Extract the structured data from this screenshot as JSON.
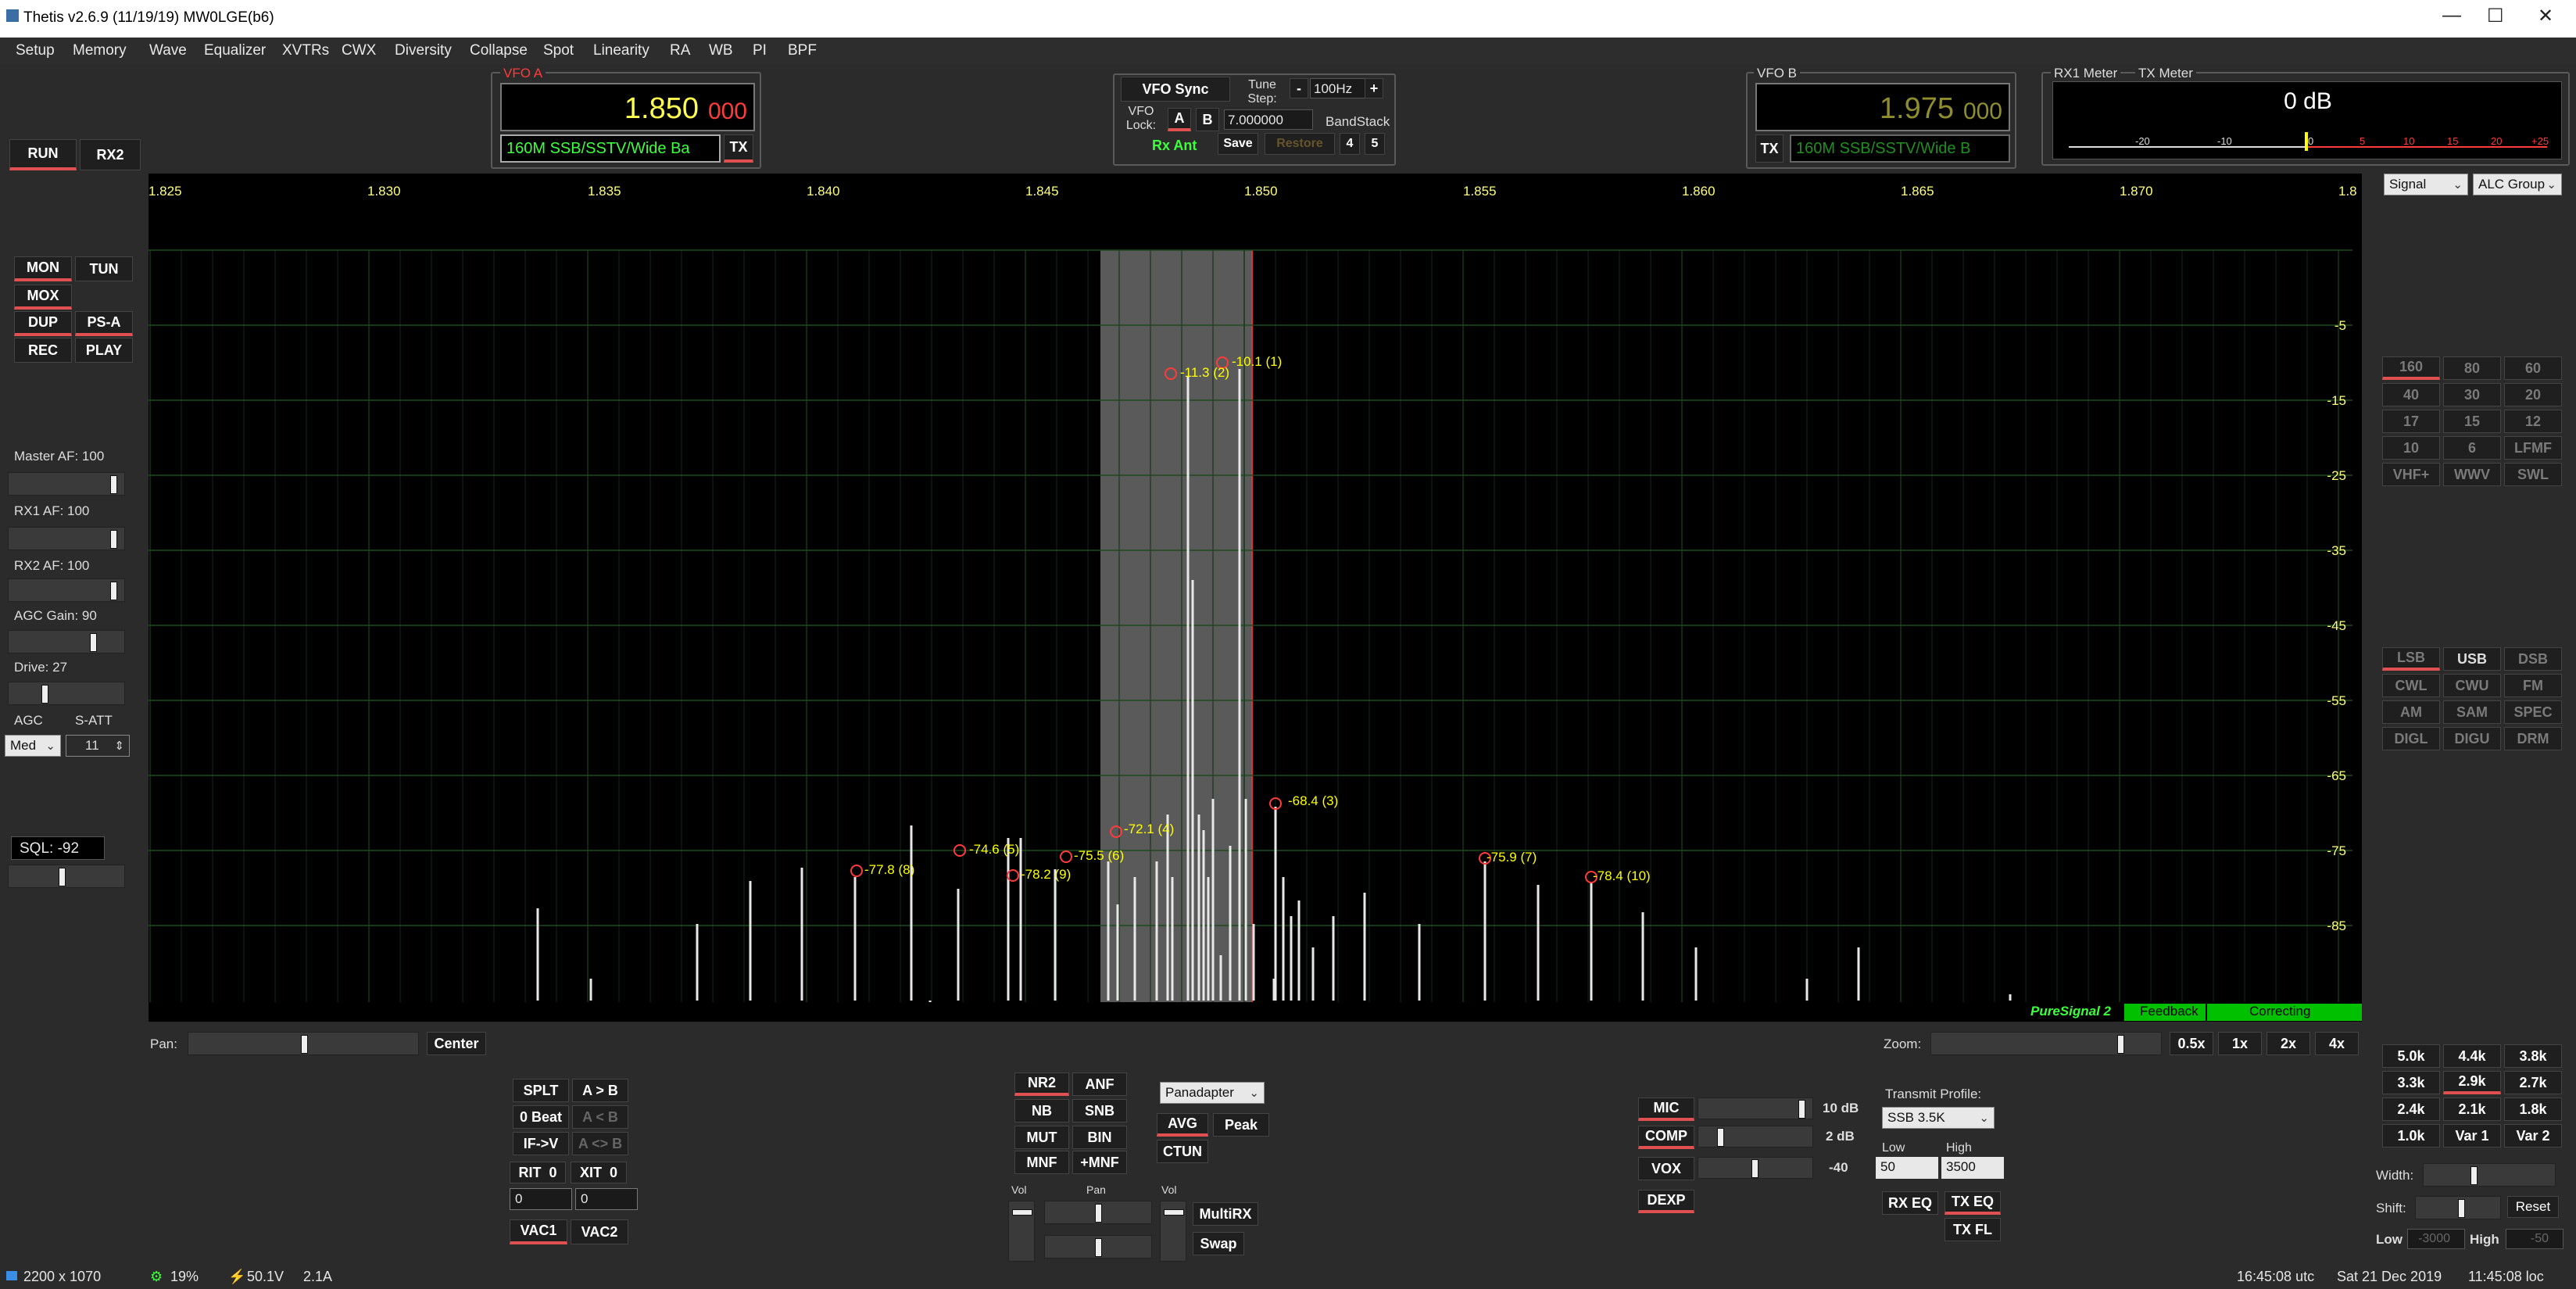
{
  "window": {
    "title": "Thetis v2.6.9 (11/19/19) MW0LGE(b6)",
    "controls": [
      "—",
      "☐",
      "✕"
    ]
  },
  "menu": [
    "Setup",
    "Memory",
    "Wave",
    "Equalizer",
    "XVTRs",
    "CWX",
    "Diversity",
    "Collapse",
    "Spot",
    "Linearity",
    "RA",
    "WB",
    "PI",
    "BPF"
  ],
  "left": {
    "run": "RUN",
    "rx2": "RX2",
    "mon": "MON",
    "tun": "TUN",
    "mox": "MOX",
    "dup": "DUP",
    "psa": "PS-A",
    "rec": "REC",
    "play": "PLAY",
    "master_af": "Master AF:  100",
    "rx1_af": "RX1 AF:  100",
    "rx2_af": "RX2 AF:  100",
    "agc_gain": "AGC Gain:  90",
    "drive": "Drive:  27",
    "agc": "AGC",
    "satt": "S-ATT",
    "agc_mode": "Med",
    "satt_value": "11",
    "sql": "SQL: -92"
  },
  "vfo_a": {
    "label": "VFO A",
    "freq_main": "1.850",
    "freq_sub": "000",
    "mode_text": "160M SSB/SSTV/Wide Ba",
    "tx": "TX"
  },
  "vfo_center": {
    "vfo_sync": "VFO Sync",
    "tune_step": "Tune Step:",
    "minus": "-",
    "plus": "+",
    "step_value": "100Hz",
    "vfo_lock": "VFO Lock:",
    "a": "A",
    "b": "B",
    "band_stack_value": "7.000000",
    "band_stack": "BandStack",
    "rx_ant": "Rx Ant",
    "save": "Save",
    "restore": "Restore",
    "n4": "4",
    "n5": "5"
  },
  "vfo_b": {
    "label": "VFO B",
    "freq_main": "1.975",
    "freq_sub": "000",
    "tx": "TX",
    "mode_text": "160M SSB/SSTV/Wide B"
  },
  "meter": {
    "rx1": "RX1 Meter",
    "tx": "TX Meter",
    "value": "0 dB",
    "scale": [
      "-20",
      "-10",
      "0",
      "5",
      "10",
      "15",
      "20",
      "+25"
    ],
    "signal_select": "Signal",
    "alc_select": "ALC Group"
  },
  "spectrum": {
    "freq_labels": [
      "1.825",
      "1.830",
      "1.835",
      "1.840",
      "1.845",
      "1.850",
      "1.855",
      "1.860",
      "1.865",
      "1.870",
      "1.8"
    ],
    "db_labels": [
      "-5",
      "-15",
      "-25",
      "-35",
      "-45",
      "-55",
      "-65",
      "-75",
      "-85"
    ],
    "peaks": [
      "-11.3 (2)",
      "-10.1 (1)",
      "-68.4 (3)",
      "-72.1 (4)",
      "-74.6 (5)",
      "-75.5 (6)",
      "-75.9 (7)",
      "-77.8 (8)",
      "-78.2 (9)",
      "-78.4 (10)"
    ],
    "ps_label": "PureSignal 2",
    "feedback": "Feedback",
    "correcting": "Correcting"
  },
  "bands": [
    "160",
    "80",
    "60",
    "40",
    "30",
    "20",
    "17",
    "15",
    "12",
    "10",
    "6",
    "LFMF",
    "VHF+",
    "WWV",
    "SWL"
  ],
  "modes": [
    "LSB",
    "USB",
    "DSB",
    "CWL",
    "CWU",
    "FM",
    "AM",
    "SAM",
    "SPEC",
    "DIGL",
    "DIGU",
    "DRM"
  ],
  "filters": [
    "5.0k",
    "4.4k",
    "3.8k",
    "3.3k",
    "2.9k",
    "2.7k",
    "2.4k",
    "2.1k",
    "1.8k",
    "1.0k",
    "Var 1",
    "Var 2"
  ],
  "filter_ctrl": {
    "width": "Width:",
    "shift": "Shift:",
    "reset": "Reset",
    "low": "Low",
    "low_val": "-3000",
    "high": "High",
    "high_val": "-50"
  },
  "pan_zoom": {
    "pan": "Pan:",
    "center": "Center",
    "zoom": "Zoom:",
    "z05": "0.5x",
    "z1": "1x",
    "z2": "2x",
    "z4": "4x"
  },
  "split": {
    "splt": "SPLT",
    "atob": "A > B",
    "zero_beat": "0 Beat",
    "btoa": "A < B",
    "ifv": "IF->V",
    "swap_ab": "A <> B",
    "rit": "RIT",
    "rit_v": "0",
    "xit": "XIT",
    "xit_v": "0",
    "rit_in": "0",
    "xit_in": "0",
    "vac1": "VAC1",
    "vac2": "VAC2"
  },
  "dsp": {
    "nr2": "NR2",
    "anf": "ANF",
    "nb": "NB",
    "snb": "SNB",
    "mut": "MUT",
    "bin": "BIN",
    "mnf": "MNF",
    "pmnf": "+MNF",
    "vol": "Vol",
    "pan": "Pan",
    "vol2": "Vol",
    "multirx": "MultiRX",
    "swap": "Swap"
  },
  "display": {
    "mode": "Panadapter",
    "avg": "AVG",
    "peak": "Peak",
    "ctun": "CTUN"
  },
  "tx": {
    "mic": "MIC",
    "mic_db": "10 dB",
    "comp": "COMP",
    "comp_db": "2 dB",
    "vox": "VOX",
    "vox_v": "-40",
    "dexp": "DEXP",
    "profile_label": "Transmit Profile:",
    "profile": "SSB 3.5K",
    "low": "Low",
    "high": "High",
    "low_v": "50",
    "high_v": "3500",
    "rx_eq": "RX EQ",
    "tx_eq": "TX EQ",
    "tx_fl": "TX FL"
  },
  "status": {
    "size": "2200 x 1070",
    "cpu": "19%",
    "volts": "50.1V",
    "amps": "2.1A",
    "utc": "16:45:08 utc",
    "date": "Sat 21 Dec 2019",
    "loc": "11:45:08 loc"
  }
}
